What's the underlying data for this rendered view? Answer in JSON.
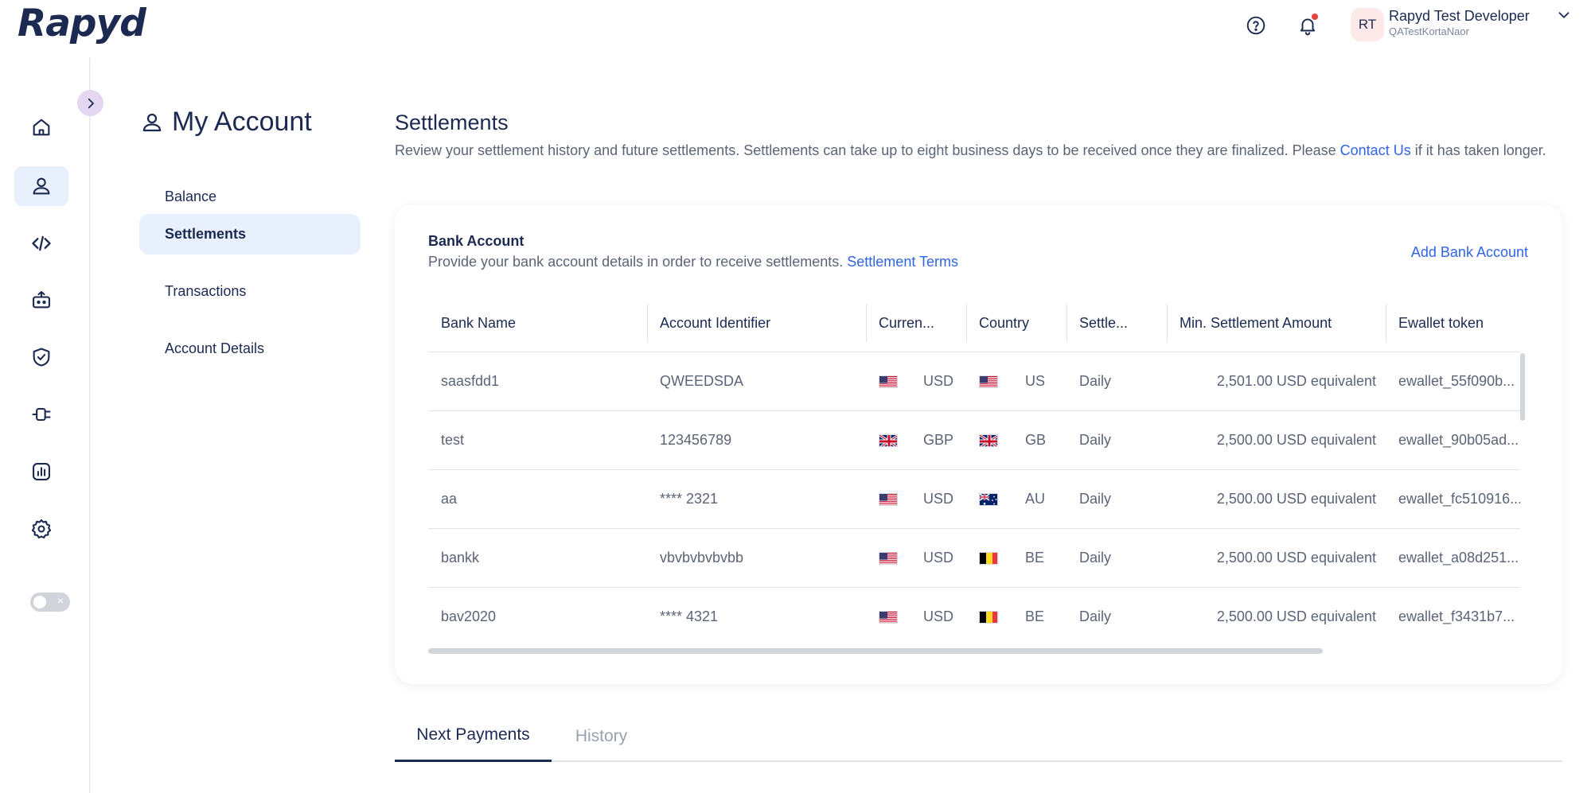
{
  "app": {
    "logo": "Rapyd"
  },
  "header": {
    "avatar_initials": "RT",
    "user_name": "Rapyd Test Developer",
    "user_sub": "QATestKortaNaor"
  },
  "rail": {
    "items": [
      "home-icon",
      "account-icon",
      "code-icon",
      "bot-icon",
      "shield-check-icon",
      "plug-icon",
      "report-icon",
      "gear-icon"
    ],
    "active": "account-icon"
  },
  "subnav": {
    "title": "My Account",
    "items": [
      {
        "label": "Balance",
        "active": false
      },
      {
        "label": "Settlements",
        "active": true
      },
      {
        "label": "Transactions",
        "active": false
      },
      {
        "label": "Account Details",
        "active": false
      }
    ]
  },
  "page": {
    "title": "Settlements",
    "desc_1": "Review your settlement history and future settlements. Settlements can take up to eight business days to be received once they are finalized. Please ",
    "desc_link": "Contact Us",
    "desc_2": " if it has taken longer."
  },
  "bank_card": {
    "title": "Bank Account",
    "desc": "Provide your bank account details in order to receive settlements. ",
    "desc_link": "Settlement Terms",
    "add_label": "Add Bank Account",
    "columns": [
      "Bank Name",
      "Account Identifier",
      "Curren...",
      "Country",
      "Settle...",
      "Min. Settlement Amount",
      "Ewallet token"
    ],
    "rows": [
      {
        "bank": "saasfdd1",
        "account": "QWEEDSDA",
        "currency": "USD",
        "currency_flag": "us",
        "country": "US",
        "country_flag": "us",
        "settle": "Daily",
        "min": "2,501.00 USD equivalent",
        "token": "ewallet_55f090b..."
      },
      {
        "bank": "test",
        "account": "123456789",
        "currency": "GBP",
        "currency_flag": "gb",
        "country": "GB",
        "country_flag": "gb",
        "settle": "Daily",
        "min": "2,500.00 USD equivalent",
        "token": "ewallet_90b05ad..."
      },
      {
        "bank": "aa",
        "account": "**** 2321",
        "currency": "USD",
        "currency_flag": "us",
        "country": "AU",
        "country_flag": "au",
        "settle": "Daily",
        "min": "2,500.00 USD equivalent",
        "token": "ewallet_fc510916..."
      },
      {
        "bank": "bankk",
        "account": "vbvbvbvbvbb",
        "currency": "USD",
        "currency_flag": "us",
        "country": "BE",
        "country_flag": "be",
        "settle": "Daily",
        "min": "2,500.00 USD equivalent",
        "token": "ewallet_a08d251..."
      },
      {
        "bank": "bav2020",
        "account": "**** 4321",
        "currency": "USD",
        "currency_flag": "us",
        "country": "BE",
        "country_flag": "be",
        "settle": "Daily",
        "min": "2,500.00 USD equivalent",
        "token": "ewallet_f3431b7..."
      }
    ]
  },
  "tabs": [
    {
      "label": "Next Payments",
      "active": true
    },
    {
      "label": "History",
      "active": false
    }
  ],
  "colors": {
    "accent": "#2f65e6",
    "navy": "#1c2a52",
    "active_bg": "#e8f0fd",
    "notify": "#e8403c"
  }
}
